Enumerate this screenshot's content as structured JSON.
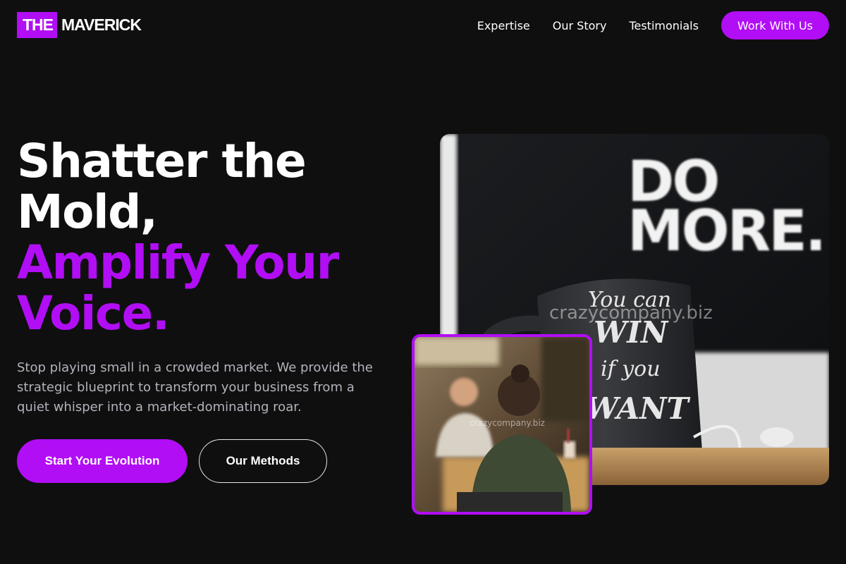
{
  "brand": {
    "logo_part1": "THE",
    "logo_part2": "MAVERICK",
    "accent_color": "#b10ef5",
    "background_color": "#0f0f10"
  },
  "nav": {
    "links": [
      "Expertise",
      "Our Story",
      "Testimonials"
    ],
    "cta_label": "Work With Us"
  },
  "hero": {
    "headline_line1": "Shatter the",
    "headline_line2": "Mold,",
    "headline_accent_line1": "Amplify Your",
    "headline_accent_line2": "Voice.",
    "description": "Stop playing small in a crowded market. We provide the strategic blueprint to transform your business from a quiet whisper into a market-dominating roar.",
    "primary_button": "Start Your Evolution",
    "secondary_button": "Our Methods"
  },
  "images": {
    "main": {
      "sign_line1": "DO",
      "sign_line2": "MORE.",
      "mug_line1": "You can",
      "mug_line2": "WIN",
      "mug_line3": "if you",
      "mug_line4": "WANT",
      "watermark": "crazycompany.biz"
    },
    "inset": {
      "watermark": "crazycompany.biz"
    }
  }
}
